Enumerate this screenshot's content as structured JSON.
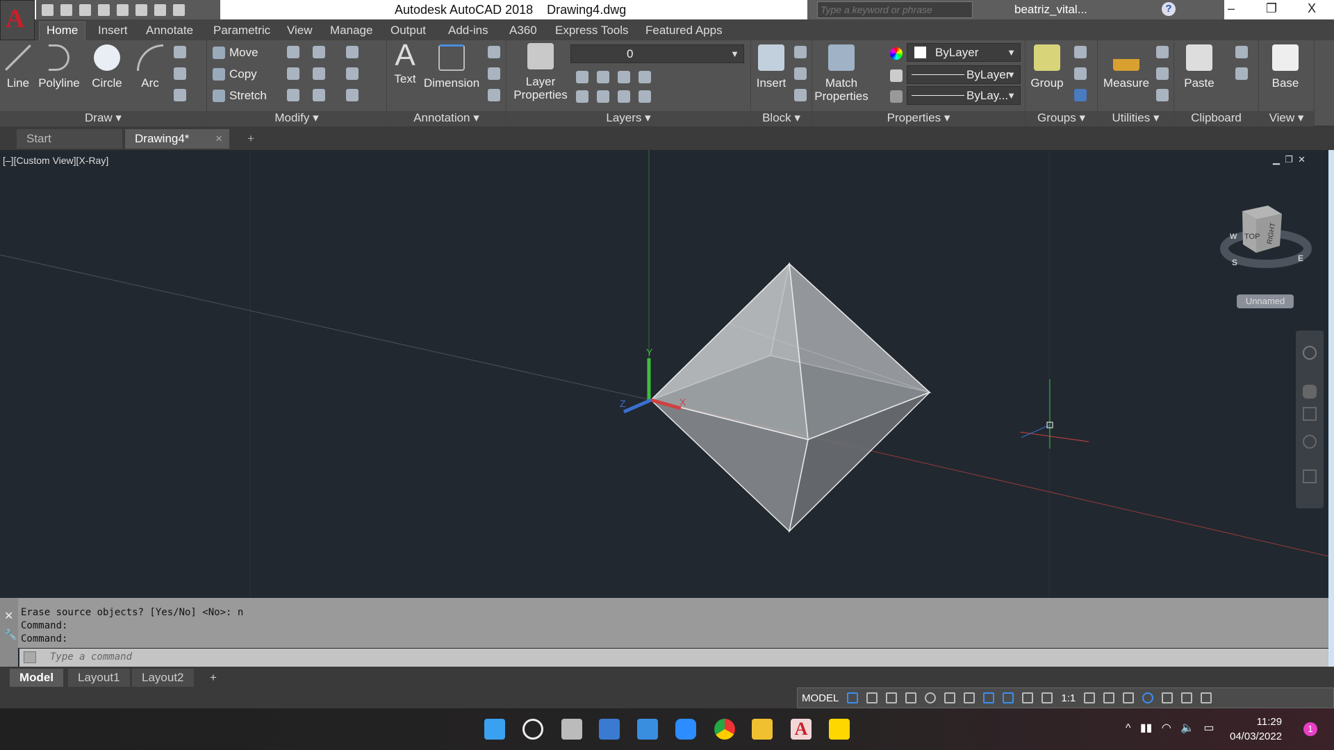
{
  "app": {
    "logo": "A",
    "title": "Autodesk AutoCAD 2018",
    "file": "Drawing4.dwg"
  },
  "search": {
    "placeholder": "Type a keyword or phrase"
  },
  "user": {
    "name": "beatriz_vital..."
  },
  "window": {
    "minimize": "–",
    "restore": "❐",
    "close": "X"
  },
  "ribbon_tabs": [
    "Home",
    "Insert",
    "Annotate",
    "Parametric",
    "View",
    "Manage",
    "Output",
    "Add-ins",
    "A360",
    "Express Tools",
    "Featured Apps"
  ],
  "panels": {
    "draw": {
      "label": "Draw ▾",
      "tools": [
        "Line",
        "Polyline",
        "Circle",
        "Arc"
      ]
    },
    "modify": {
      "label": "Modify ▾",
      "tools": [
        "Move",
        "Copy",
        "Stretch"
      ]
    },
    "annotation": {
      "label": "Annotation ▾",
      "tools": [
        "Text",
        "Dimension"
      ]
    },
    "layers": {
      "label": "Layers ▾",
      "tool": "Layer Properties",
      "current_layer": "0"
    },
    "block": {
      "label": "Block ▾",
      "tool": "Insert"
    },
    "properties": {
      "label": "Properties ▾",
      "tool": "Match Properties",
      "color": "ByLayer",
      "linetype": "ByLayer",
      "lineweight": "ByLay..."
    },
    "groups": {
      "label": "Groups ▾",
      "tool": "Group"
    },
    "utilities": {
      "label": "Utilities ▾",
      "tool": "Measure"
    },
    "clipboard": {
      "label": "Clipboard",
      "tool": "Paste"
    },
    "view": {
      "label": "View ▾",
      "tool": "Base"
    }
  },
  "file_tabs": [
    "Start",
    "Drawing4*"
  ],
  "viewport": {
    "label": "[–][Custom View][X-Ray]",
    "viewcube": {
      "face_top": "TOP",
      "face_right": "RIGHT",
      "compass": [
        "W",
        "S",
        "E"
      ]
    },
    "view_name": "Unnamed",
    "ucs": {
      "x": "X",
      "y": "Y",
      "z": "Z"
    }
  },
  "command": {
    "history": [
      "Erase source objects? [Yes/No] <No>: n",
      "Command:",
      "Command:"
    ],
    "placeholder": "Type a command"
  },
  "layout_tabs": [
    "Model",
    "Layout1",
    "Layout2"
  ],
  "status": {
    "model": "MODEL",
    "scale": "1:1"
  },
  "clock": {
    "time": "11:29",
    "date": "04/03/2022"
  },
  "notifications": "1",
  "colors": {
    "accent": "#c8202a",
    "y_axis": "#3cbf3c",
    "x_axis": "#d04040",
    "z_axis": "#3a70d0",
    "viewport_bg": "#212830"
  }
}
